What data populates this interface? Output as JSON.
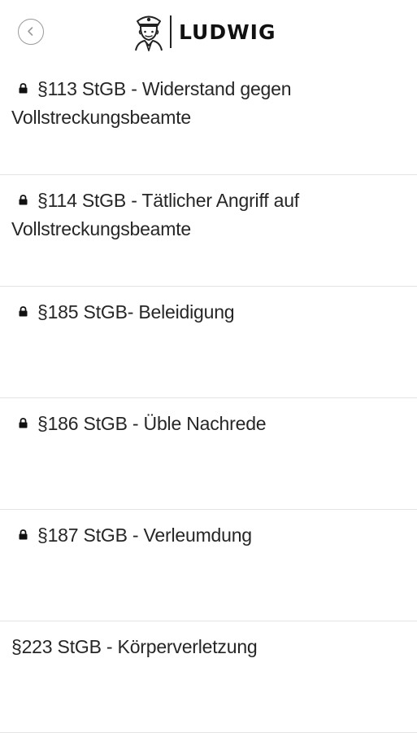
{
  "header": {
    "back_icon": "chevron-left-icon",
    "logo_icon": "officer-icon",
    "logo_text": "LUDWIG"
  },
  "items": [
    {
      "label": "§113 StGB - Widerstand gegen Vollstreckungsbeamte",
      "locked": true,
      "icon": "lock-icon"
    },
    {
      "label": "§114 StGB - Tätlicher Angriff auf Vollstreckungsbeamte",
      "locked": true,
      "icon": "lock-icon"
    },
    {
      "label": "§185 StGB- Beleidigung",
      "locked": true,
      "icon": "lock-icon"
    },
    {
      "label": "§186 StGB - Üble Nachrede",
      "locked": true,
      "icon": "lock-icon"
    },
    {
      "label": "§187 StGB - Verleumdung",
      "locked": true,
      "icon": "lock-icon"
    },
    {
      "label": "§223 StGB - Körperverletzung",
      "locked": false
    }
  ]
}
